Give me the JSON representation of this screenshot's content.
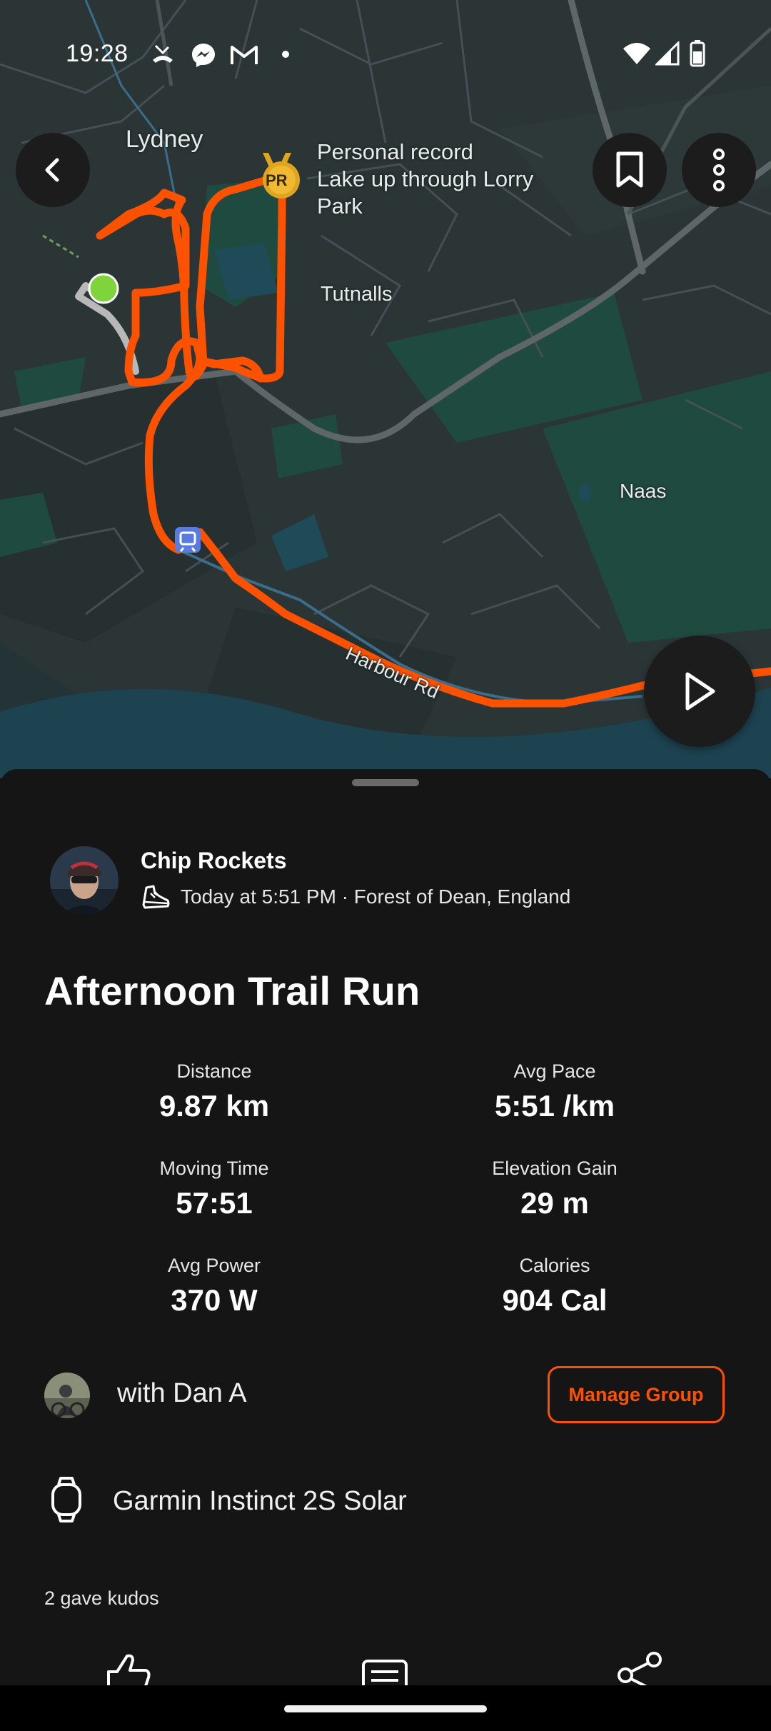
{
  "status_bar": {
    "time": "19:28"
  },
  "map": {
    "labels": {
      "town": "Lydney",
      "pr_line1": "Personal record",
      "pr_line2": "Lake up through Lorry",
      "pr_line3": "Park",
      "area1": "Tutnalls",
      "area2": "Naas",
      "road": "Harbour Rd"
    },
    "pr_badge": "PR",
    "colors": {
      "route": "#fc5200",
      "start_marker": "#7ed43a",
      "land": "#2b3536",
      "water": "#1f4a57",
      "park": "#1f4a3f"
    }
  },
  "activity": {
    "athlete_name": "Chip Rockets",
    "meta": "Today at 5:51 PM · Forest of Dean, England",
    "sport_icon": "running-shoe-icon",
    "title": "Afternoon Trail Run",
    "stats": [
      {
        "label": "Distance",
        "value": "9.87 km"
      },
      {
        "label": "Avg Pace",
        "value": "5:51 /km"
      },
      {
        "label": "Moving Time",
        "value": "57:51"
      },
      {
        "label": "Elevation Gain",
        "value": "29 m"
      },
      {
        "label": "Avg Power",
        "value": "370 W"
      },
      {
        "label": "Calories",
        "value": "904 Cal"
      }
    ],
    "group": {
      "with_text": "with Dan A",
      "manage_label": "Manage Group"
    },
    "device": "Garmin Instinct 2S Solar",
    "kudos": "2 gave kudos"
  },
  "theme": {
    "accent": "#fc5200",
    "background": "#151515"
  }
}
